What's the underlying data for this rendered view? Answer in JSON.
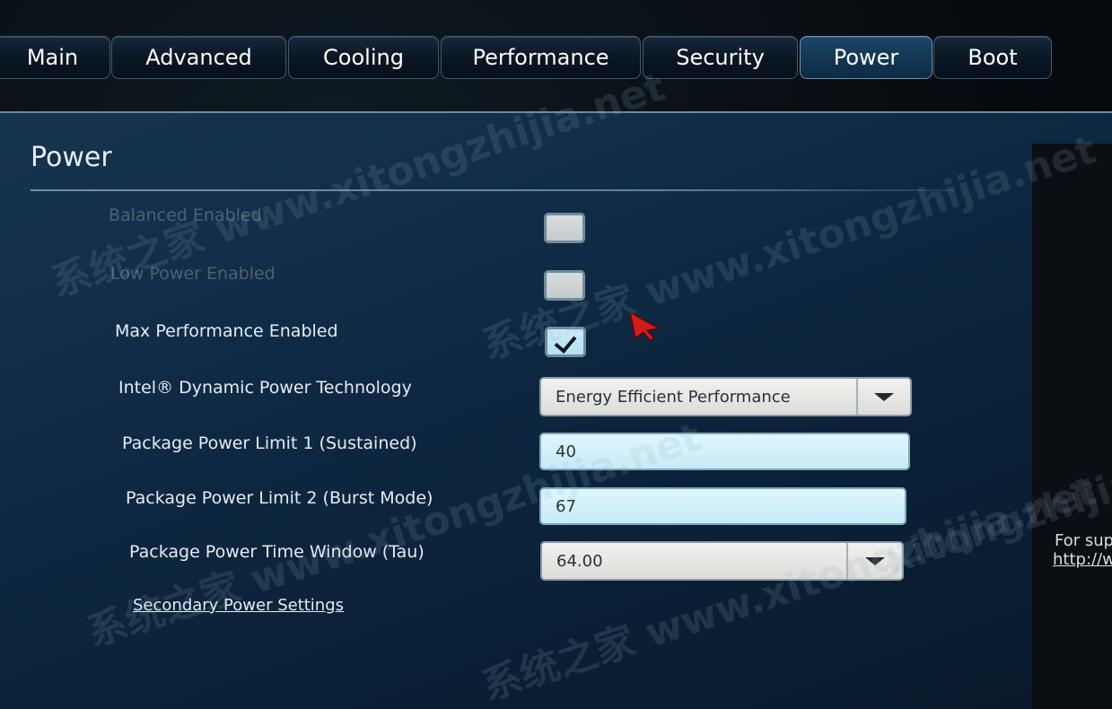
{
  "tabs": [
    "Main",
    "Advanced",
    "Cooling",
    "Performance",
    "Security",
    "Power",
    "Boot"
  ],
  "active_tab": "Power",
  "panel": {
    "title": "Power",
    "balanced_enabled": {
      "label": "Balanced Enabled",
      "checked": false
    },
    "low_power_enabled": {
      "label": "Low Power Enabled",
      "checked": false
    },
    "max_performance_enabled": {
      "label": "Max Performance Enabled",
      "checked": true
    },
    "dynamic_power": {
      "label": "Intel® Dynamic Power Technology",
      "value": "Energy Efficient Performance"
    },
    "pl1": {
      "label": "Package Power Limit 1 (Sustained)",
      "value": "40"
    },
    "pl2": {
      "label": "Package Power Limit 2 (Burst Mode)",
      "value": "67"
    },
    "tau": {
      "label": "Package Power Time Window (Tau)",
      "value": "64.00"
    },
    "secondary_link": "Secondary Power Settings"
  },
  "side": {
    "text": "For sup",
    "link": "http://w"
  },
  "watermark": [
    "系统之家 www.xitongzhijia.net",
    "xitongzhijia.net"
  ],
  "icons": {
    "cursor": "arrow-cursor-icon",
    "dropdown": "chevron-down-icon",
    "check": "checkmark-icon"
  },
  "colors": {
    "accent": "#123553",
    "panel": "#0f2a44",
    "field": "#c6ecf6"
  }
}
